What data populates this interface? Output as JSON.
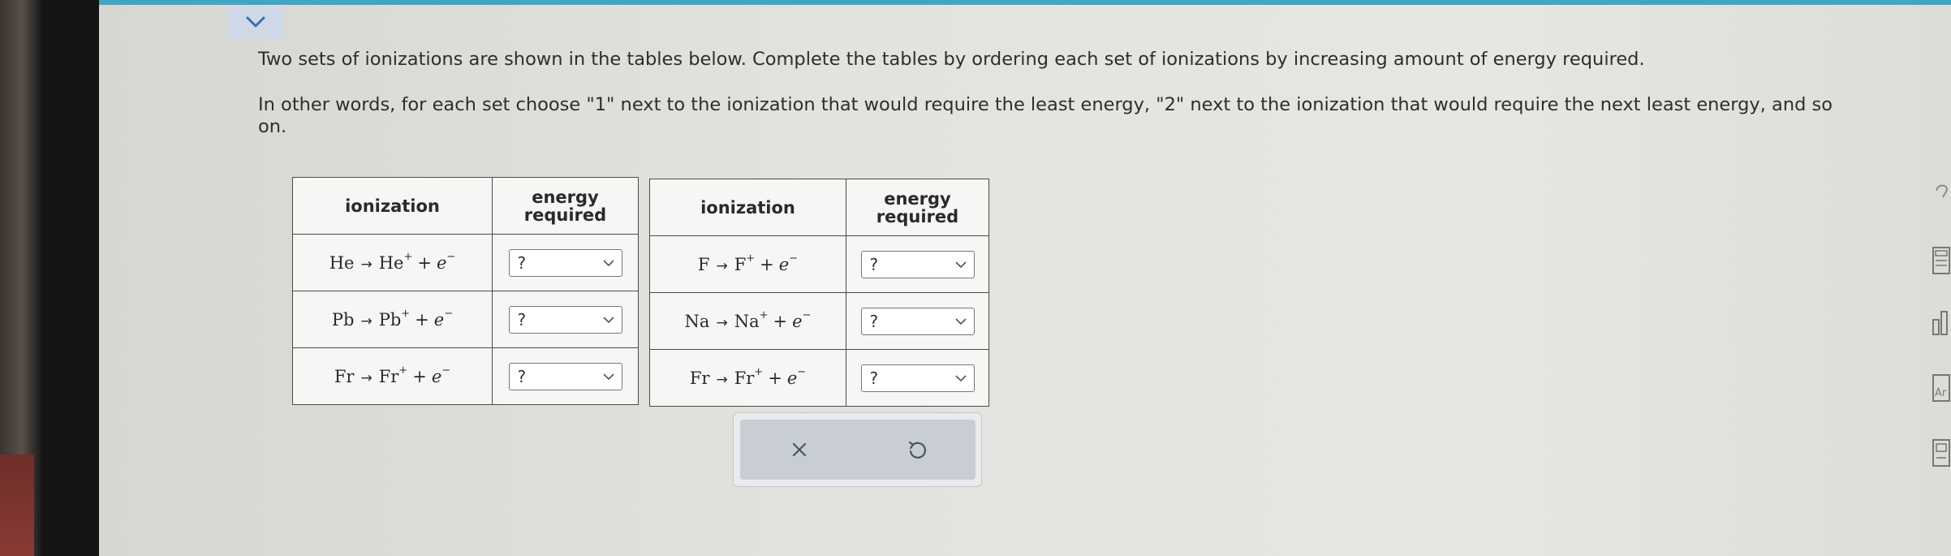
{
  "instructions": {
    "p1": "Two sets of ionizations are shown in the tables below. Complete the tables by ordering each set of ionizations by increasing amount of energy required.",
    "p2": "In other words, for each set choose \"1\" next to the ionization that would require the least energy, \"2\" next to the ionization that would require the next least energy, and so on."
  },
  "tables": [
    {
      "headers": {
        "ionization": "ionization",
        "energy_line1": "energy",
        "energy_line2": "required"
      },
      "rows": [
        {
          "reactant": "He",
          "product": "He",
          "charge": "+",
          "electron": "e",
          "eminus": "−",
          "selected": "?"
        },
        {
          "reactant": "Pb",
          "product": "Pb",
          "charge": "+",
          "electron": "e",
          "eminus": "−",
          "selected": "?"
        },
        {
          "reactant": "Fr",
          "product": "Fr",
          "charge": "+",
          "electron": "e",
          "eminus": "−",
          "selected": "?"
        }
      ]
    },
    {
      "headers": {
        "ionization": "ionization",
        "energy_line1": "energy",
        "energy_line2": "required"
      },
      "rows": [
        {
          "reactant": "F",
          "product": "F",
          "charge": "+",
          "electron": "e",
          "eminus": "−",
          "selected": "?"
        },
        {
          "reactant": "Na",
          "product": "Na",
          "charge": "+",
          "electron": "e",
          "eminus": "−",
          "selected": "?"
        },
        {
          "reactant": "Fr",
          "product": "Fr",
          "charge": "+",
          "electron": "e",
          "eminus": "−",
          "selected": "?"
        }
      ]
    }
  ],
  "actions": {
    "clear_icon": "close-icon",
    "undo_icon": "undo-icon"
  },
  "side_tools": [
    "help-icon",
    "calculator-icon",
    "chart-icon",
    "periodic-table-icon",
    "reference-icon"
  ],
  "colors": {
    "accent_bar": "#3ea6c6",
    "dropdown_bg": "#ffffff",
    "action_panel": "#c8ced4"
  }
}
